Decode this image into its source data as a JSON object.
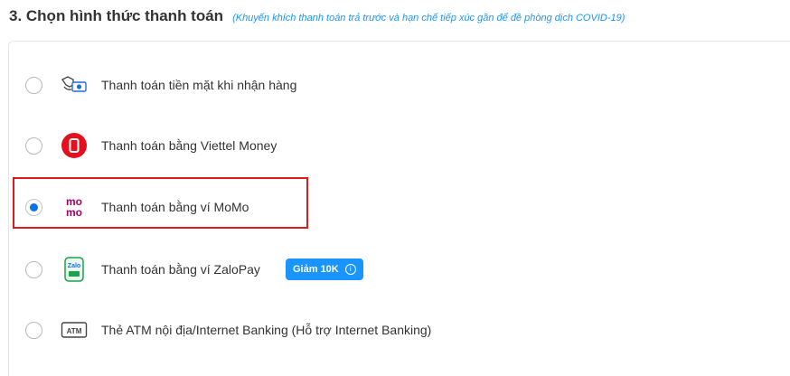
{
  "header": {
    "title": "3. Chọn hình thức thanh toán",
    "note": "(Khuyến khích thanh toán trả trước và hạn chế tiếp xúc gần để đề phòng dịch COVID-19)"
  },
  "payment_options": [
    {
      "label": "Thanh toán tiền mặt khi nhận hàng",
      "icon": "cash-on-delivery-icon",
      "selected": false
    },
    {
      "label": "Thanh toán bằng Viettel Money",
      "icon": "viettel-money-icon",
      "selected": false
    },
    {
      "label": "Thanh toán bằng ví MoMo",
      "icon": "momo-icon",
      "icon_text": "mo mo",
      "selected": true
    },
    {
      "label": "Thanh toán bằng ví ZaloPay",
      "icon": "zalopay-icon",
      "icon_text": "Zalo",
      "selected": false,
      "badge": "Giảm 10K"
    },
    {
      "label": "Thẻ ATM nội địa/Internet Banking (Hỗ trợ Internet Banking)",
      "icon": "atm-card-icon",
      "icon_text": "ATM",
      "selected": false
    }
  ],
  "colors": {
    "accent": "#1a94ff",
    "highlight": "#e0191f",
    "momo": "#a50064",
    "viettel": "#e5101d"
  }
}
